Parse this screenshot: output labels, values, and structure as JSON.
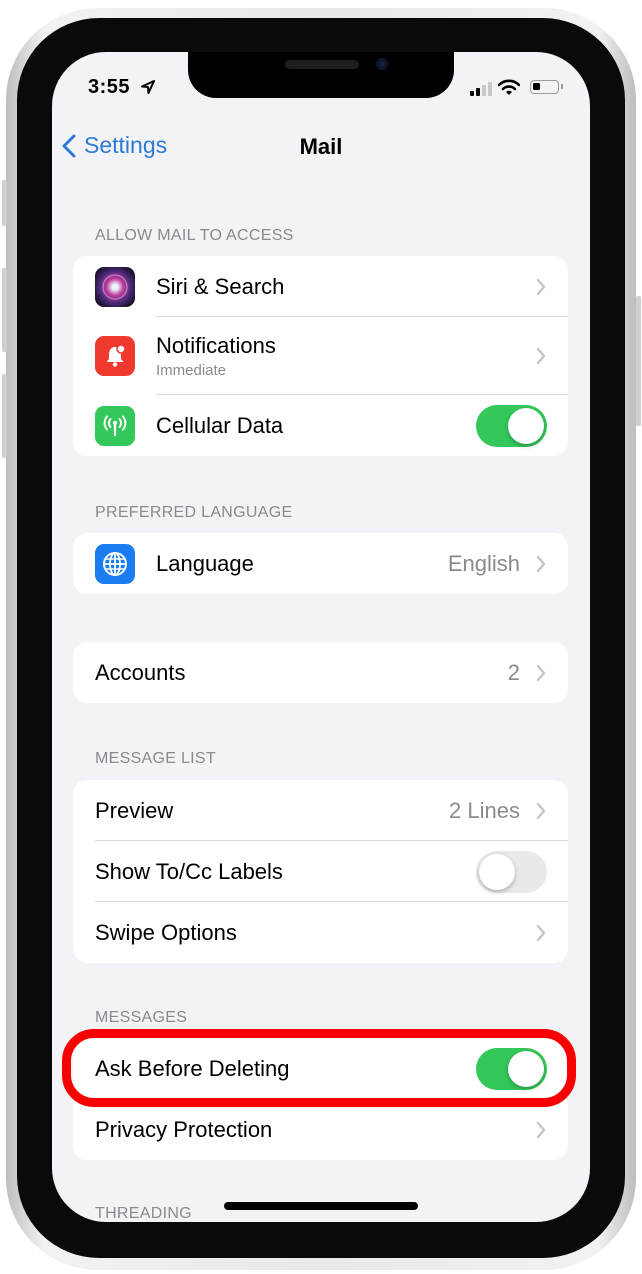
{
  "status_bar": {
    "time": "3:55",
    "location_icon": "location-arrow-icon",
    "signal_icon": "cellular-signal-icon",
    "wifi_icon": "wifi-icon",
    "battery_icon": "battery-icon"
  },
  "nav": {
    "back_label": "Settings",
    "back_icon": "chevron-left-icon",
    "title": "Mail"
  },
  "sections": {
    "allow_access": {
      "header": "Allow Mail to Access",
      "items": [
        {
          "label": "Siri & Search",
          "icon": "siri-icon",
          "accessory": "chevron"
        },
        {
          "label": "Notifications",
          "sublabel": "Immediate",
          "icon": "bell-icon",
          "accessory": "chevron"
        },
        {
          "label": "Cellular Data",
          "icon": "antenna-icon",
          "accessory": "toggle",
          "toggle_on": true
        }
      ]
    },
    "language": {
      "header": "Preferred Language",
      "items": [
        {
          "label": "Language",
          "value": "English",
          "icon": "globe-icon",
          "accessory": "chevron"
        }
      ]
    },
    "accounts": {
      "items": [
        {
          "label": "Accounts",
          "value": "2",
          "accessory": "chevron"
        }
      ]
    },
    "message_list": {
      "header": "Message List",
      "items": [
        {
          "label": "Preview",
          "value": "2 Lines",
          "accessory": "chevron"
        },
        {
          "label": "Show To/Cc Labels",
          "accessory": "toggle",
          "toggle_on": false
        },
        {
          "label": "Swipe Options",
          "accessory": "chevron"
        }
      ]
    },
    "messages": {
      "header": "Messages",
      "items": [
        {
          "label": "Ask Before Deleting",
          "accessory": "toggle",
          "toggle_on": true,
          "highlighted": true
        },
        {
          "label": "Privacy Protection",
          "accessory": "chevron"
        }
      ]
    },
    "threading": {
      "header": "Threading"
    }
  },
  "colors": {
    "accent_blue": "#2d7ad6",
    "toggle_on": "#34c759",
    "toggle_off": "#e9e9eb",
    "highlight_red": "#f80000",
    "background": "#f2f2f7"
  }
}
